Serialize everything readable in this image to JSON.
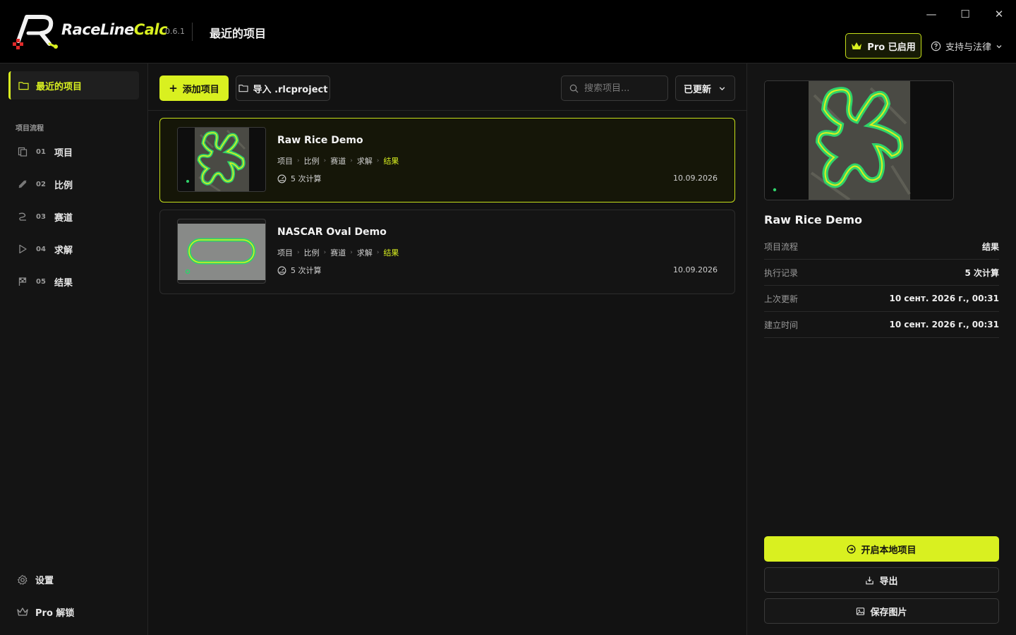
{
  "app": {
    "name_part1": "RaceLine",
    "name_part2": "Calc",
    "version": "0.6.1",
    "page_title": "最近的项目",
    "pro_badge": "Pro 已启用",
    "support_menu": "支持与法律",
    "accent_color": "#d9f020"
  },
  "window_controls": {
    "minimize": "—",
    "maximize": "☐",
    "close": "✕"
  },
  "sidebar": {
    "active_item": "最近的项目",
    "section_label": "项目流程",
    "steps": [
      {
        "num": "01",
        "label": "项目",
        "icon": "file-copy-icon"
      },
      {
        "num": "02",
        "label": "比例",
        "icon": "ruler-icon"
      },
      {
        "num": "03",
        "label": "赛道",
        "icon": "route-icon"
      },
      {
        "num": "04",
        "label": "求解",
        "icon": "play-icon"
      },
      {
        "num": "05",
        "label": "结果",
        "icon": "flag-icon"
      }
    ],
    "settings": "设置",
    "pro_unlock": "Pro 解锁"
  },
  "toolbar": {
    "add_project": "添加项目",
    "import_project": "导入 .rlcproject",
    "search_placeholder": "搜索项目...",
    "sort_value": "已更新"
  },
  "projects": [
    {
      "title": "Raw Rice Demo",
      "steps": [
        "项目",
        "比例",
        "赛道",
        "求解",
        "结果"
      ],
      "runs": "5 次计算",
      "date": "10.09.2026",
      "selected": true
    },
    {
      "title": "NASCAR Oval Demo",
      "steps": [
        "项目",
        "比例",
        "赛道",
        "求解",
        "结果"
      ],
      "runs": "5 次计算",
      "date": "10.09.2026",
      "selected": false
    }
  ],
  "details": {
    "title": "Raw Rice Demo",
    "rows": [
      {
        "key": "项目流程",
        "value": "结果"
      },
      {
        "key": "执行记录",
        "value": "5 次计算"
      },
      {
        "key": "上次更新",
        "value": "10 сент. 2026 г., 00:31"
      },
      {
        "key": "建立时间",
        "value": "10 сент. 2026 г., 00:31"
      }
    ],
    "open_local": "开启本地项目",
    "export": "导出",
    "save_image": "保存图片"
  }
}
